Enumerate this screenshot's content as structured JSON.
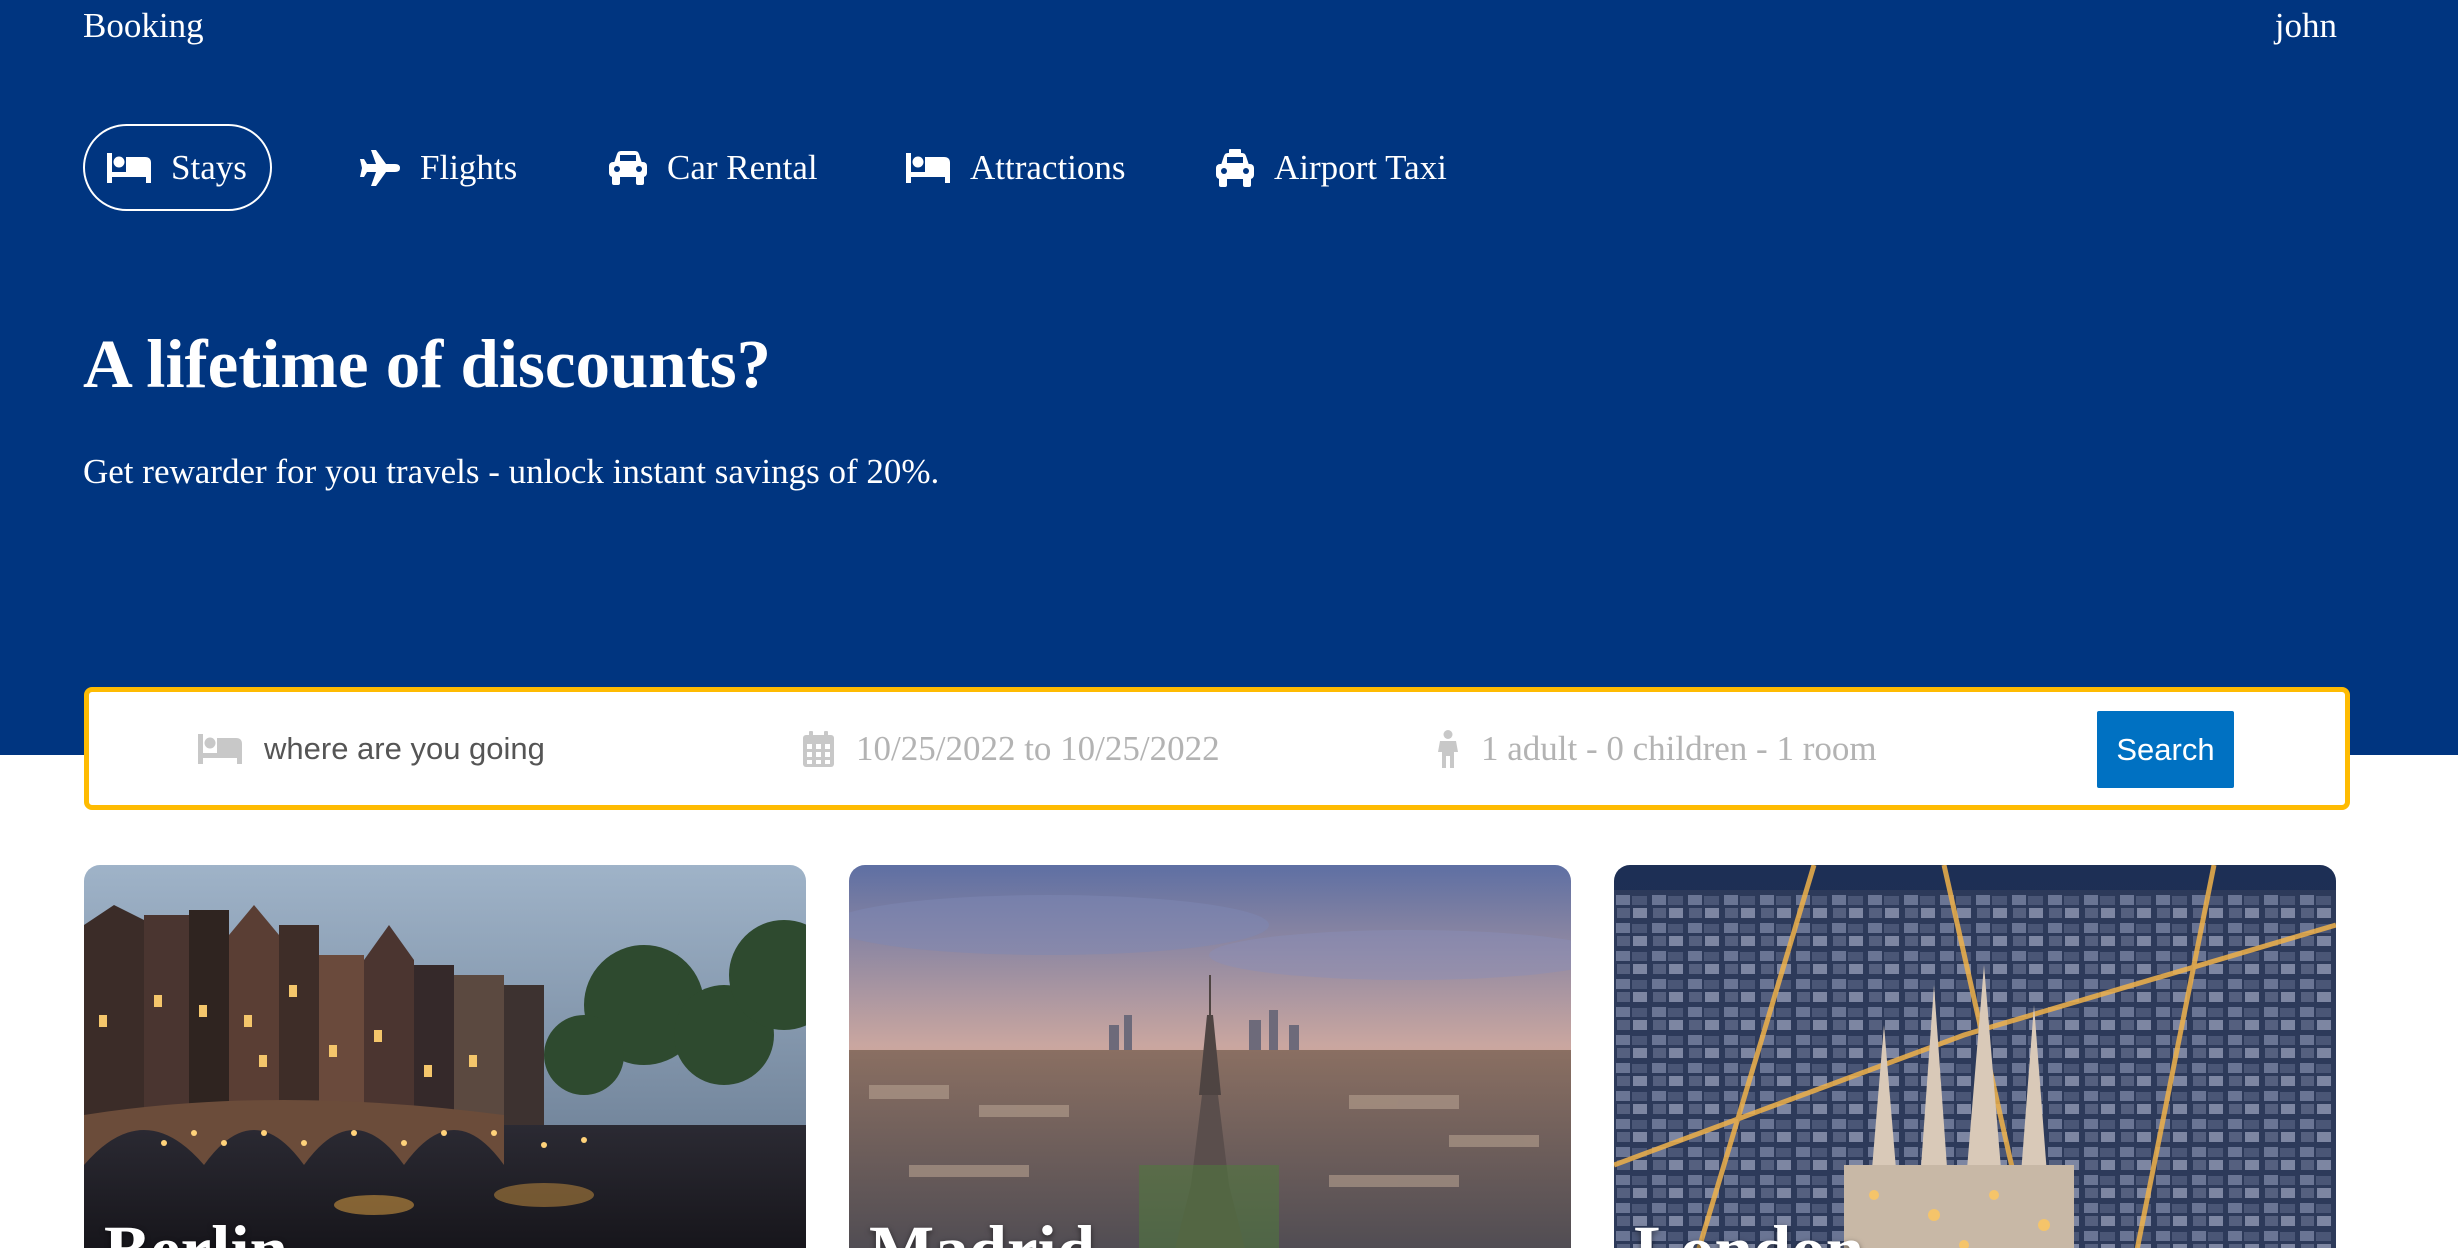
{
  "header": {
    "brand": "Booking",
    "user": "john",
    "background_color": "#003580"
  },
  "nav": {
    "items": [
      {
        "label": "Stays",
        "icon": "bed-icon",
        "active": true
      },
      {
        "label": "Flights",
        "icon": "plane-icon",
        "active": false
      },
      {
        "label": "Car Rental",
        "icon": "car-icon",
        "active": false
      },
      {
        "label": "Attractions",
        "icon": "bed-icon",
        "active": false
      },
      {
        "label": "Airport Taxi",
        "icon": "taxi-icon",
        "active": false
      }
    ]
  },
  "hero": {
    "title": "A lifetime of discounts?",
    "subtitle": "Get rewarder for you travels - unlock instant savings of 20%."
  },
  "search": {
    "destination_placeholder": "where are you going",
    "destination_value": "",
    "destination_icon": "bed-icon",
    "dates": "10/25/2022 to 10/25/2022",
    "dates_icon": "calendar-icon",
    "guests": "1 adult - 0 children - 1 room",
    "guests_icon": "person-icon",
    "button_label": "Search",
    "border_color": "#febb02",
    "button_color": "#0071c2"
  },
  "featured": {
    "cards": [
      {
        "title": "Berlin",
        "image": "canal-bridge-evening-photo"
      },
      {
        "title": "Madrid",
        "image": "eiffel-tower-city-skyline-photo"
      },
      {
        "title": "London",
        "image": "aerial-city-night-cathedral-photo"
      }
    ]
  }
}
